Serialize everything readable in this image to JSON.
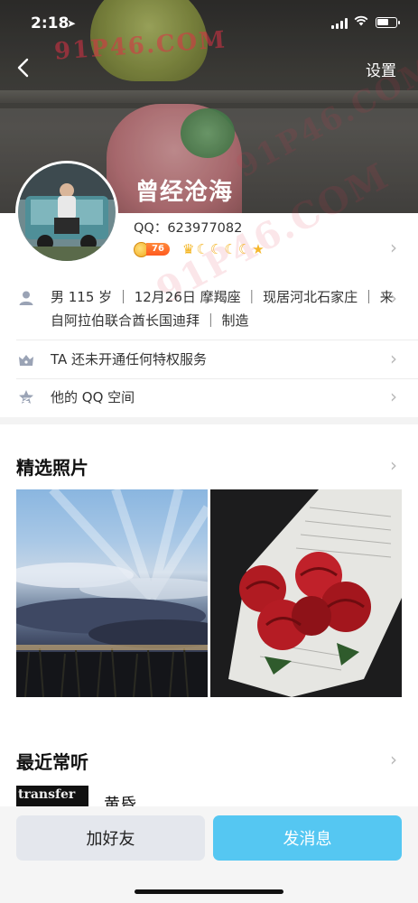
{
  "status_bar": {
    "time": "2:18",
    "location_icon": "location-arrow-icon",
    "signal_icon": "cellular-signal-icon",
    "wifi_icon": "wifi-icon",
    "battery_icon": "battery-icon"
  },
  "nav": {
    "back_icon": "chevron-left-icon",
    "settings_label": "设置"
  },
  "watermark": "91P46.COM",
  "profile": {
    "nickname": "曾经沧海",
    "qq_number": "QQ：623977082",
    "level_badge": "76",
    "level_icons": [
      "crown-icon",
      "moon-icon",
      "moon-icon",
      "moon-icon",
      "moon-icon",
      "star-icon"
    ]
  },
  "info_rows": [
    {
      "icon": "person-icon",
      "line1": "男 115 岁 ｜ 12月26日 摩羯座 ｜ 现居河北石家庄 ｜ 来",
      "line2": "自阿拉伯联合酋长国迪拜 ｜ 制造"
    },
    {
      "icon": "vip-crown-icon",
      "line1": "TA 还未开通任何特权服务"
    },
    {
      "icon": "star-space-icon",
      "line1": "他的 QQ 空间"
    }
  ],
  "photos_section": {
    "title": "精选照片",
    "photos": [
      "sky-clouds-photo",
      "red-roses-bouquet-photo"
    ]
  },
  "music_section": {
    "title": "最近常听",
    "album_text": "transfer",
    "song_title": "黄昏"
  },
  "actions": {
    "add_friend": "加好友",
    "send_message": "发消息"
  },
  "colors": {
    "primary_button": "#55c7f2",
    "secondary_button": "#e4e7ed",
    "level_orange": "#ff5a1f"
  }
}
